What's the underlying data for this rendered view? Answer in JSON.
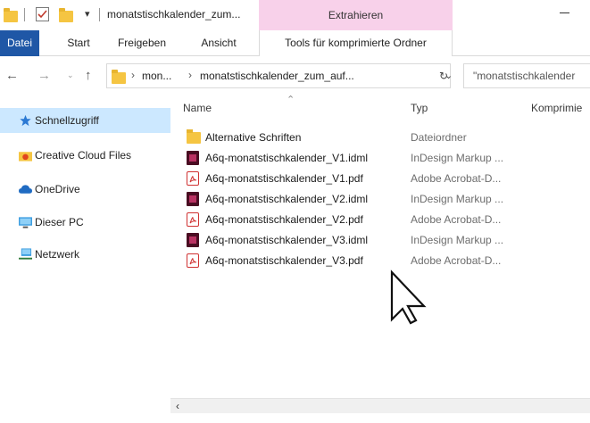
{
  "window": {
    "title": "monatstischkalender_zum...",
    "context_tab_header": "Extrahieren"
  },
  "ribbon": {
    "tabs": [
      "Datei",
      "Start",
      "Freigeben",
      "Ansicht",
      "Tools für komprimierte Ordner"
    ]
  },
  "address": {
    "crumbs": [
      "mon...",
      "monatstischkalender_zum_auf..."
    ],
    "search_placeholder": "\"monatstischkalender"
  },
  "sidebar": {
    "items": [
      {
        "label": "Schnellzugriff",
        "icon": "star-icon"
      },
      {
        "label": "Creative Cloud Files",
        "icon": "creative-cloud-icon"
      },
      {
        "label": "OneDrive",
        "icon": "cloud-icon"
      },
      {
        "label": "Dieser PC",
        "icon": "computer-icon"
      },
      {
        "label": "Netzwerk",
        "icon": "network-icon"
      }
    ]
  },
  "columns": {
    "name": "Name",
    "type": "Typ",
    "compressed": "Komprimie"
  },
  "files": [
    {
      "name": "Alternative Schriften",
      "type": "Dateiordner",
      "icon": "folder-icon"
    },
    {
      "name": "A6q-monatstischkalender_V1.idml",
      "type": "InDesign Markup ...",
      "icon": "indesign-icon"
    },
    {
      "name": "A6q-monatstischkalender_V1.pdf",
      "type": "Adobe Acrobat-D...",
      "icon": "pdf-icon"
    },
    {
      "name": "A6q-monatstischkalender_V2.idml",
      "type": "InDesign Markup ...",
      "icon": "indesign-icon"
    },
    {
      "name": "A6q-monatstischkalender_V2.pdf",
      "type": "Adobe Acrobat-D...",
      "icon": "pdf-icon"
    },
    {
      "name": "A6q-monatstischkalender_V3.idml",
      "type": "InDesign Markup ...",
      "icon": "indesign-icon"
    },
    {
      "name": "A6q-monatstischkalender_V3.pdf",
      "type": "Adobe Acrobat-D...",
      "icon": "pdf-icon"
    }
  ],
  "colors": {
    "file_tab": "#1f57a6",
    "context_tab": "#f8d1ea",
    "selection": "#cce8ff",
    "folder": "#f5c542"
  }
}
